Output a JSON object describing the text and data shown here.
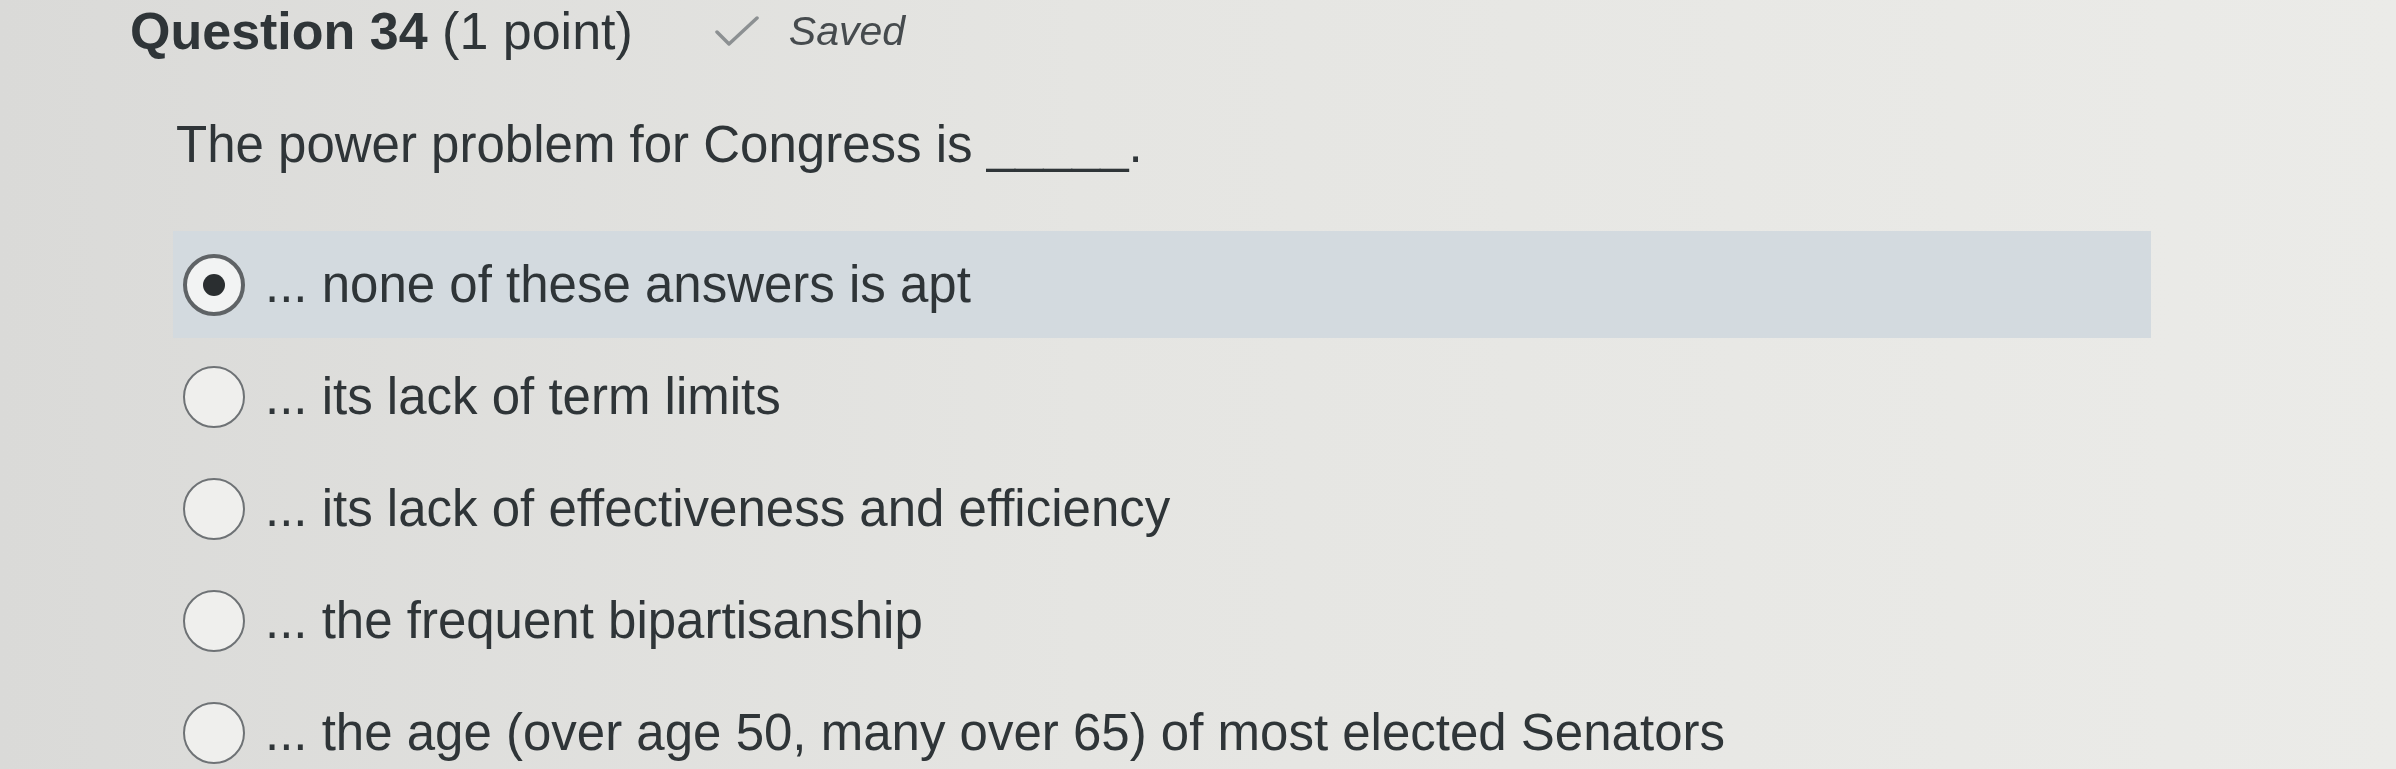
{
  "question": {
    "title": "**Question 34** (1 point)",
    "status": {
      "kind": "saved",
      "label": "Saved"
    },
    "prompt": "The power problem for Congress is _____."
  },
  "options": [
    {
      "label": "... none of these answers is apt",
      "selected": true
    },
    {
      "label": "... its lack of term limits",
      "selected": false
    },
    {
      "label": "... its lack of effectiveness and efficiency",
      "selected": false
    },
    {
      "label": "... the frequent bipartisanship",
      "selected": false
    },
    {
      "label": "... the age (over age 50, many over 65) of most elected Senators",
      "selected": false
    }
  ]
}
